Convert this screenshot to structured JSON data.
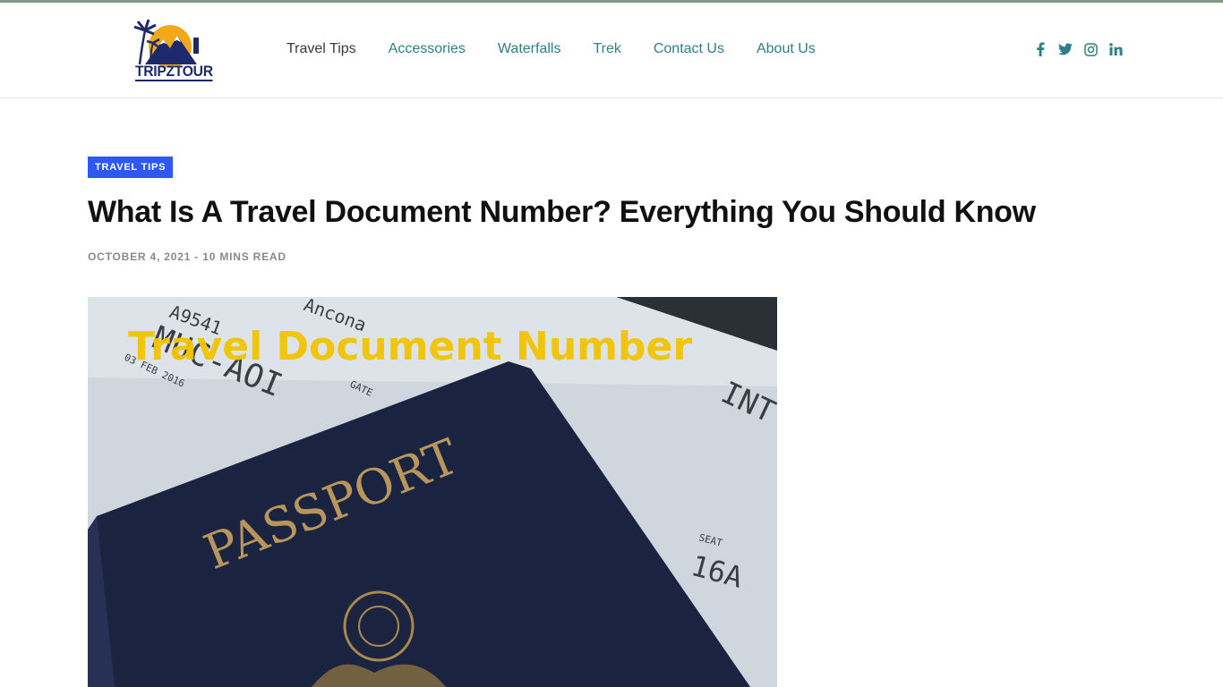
{
  "brand": {
    "logo_text": "TRIPZTOUR"
  },
  "nav": {
    "items": [
      {
        "label": "Travel Tips",
        "active": true
      },
      {
        "label": "Accessories",
        "active": false
      },
      {
        "label": "Waterfalls",
        "active": false
      },
      {
        "label": "Trek",
        "active": false
      },
      {
        "label": "Contact Us",
        "active": false
      },
      {
        "label": "About Us",
        "active": false
      }
    ]
  },
  "social": [
    "facebook-icon",
    "twitter-icon",
    "instagram-icon",
    "linkedin-icon"
  ],
  "colors": {
    "accent": "#2f7f85",
    "badge": "#2d59f2",
    "topbar": "#7f9a88"
  },
  "article": {
    "category": "TRAVEL TIPS",
    "title": "What Is A Travel Document Number? Everything You Should Know",
    "date": "OCTOBER 4, 2021",
    "separator": "-",
    "read_time": "10 MINS READ",
    "hero": {
      "overlay_title": "Travel Document Number",
      "passport_text": "PASSPORT",
      "ticket_code": "MUC-AOI",
      "ticket_number": "A9541",
      "ticket_city": "Ancona",
      "ticket_date": "03 FEB 2016",
      "gate_label": "GATE",
      "int_label": "INT",
      "seat_label": "SEAT",
      "seat_value": "16A"
    }
  }
}
